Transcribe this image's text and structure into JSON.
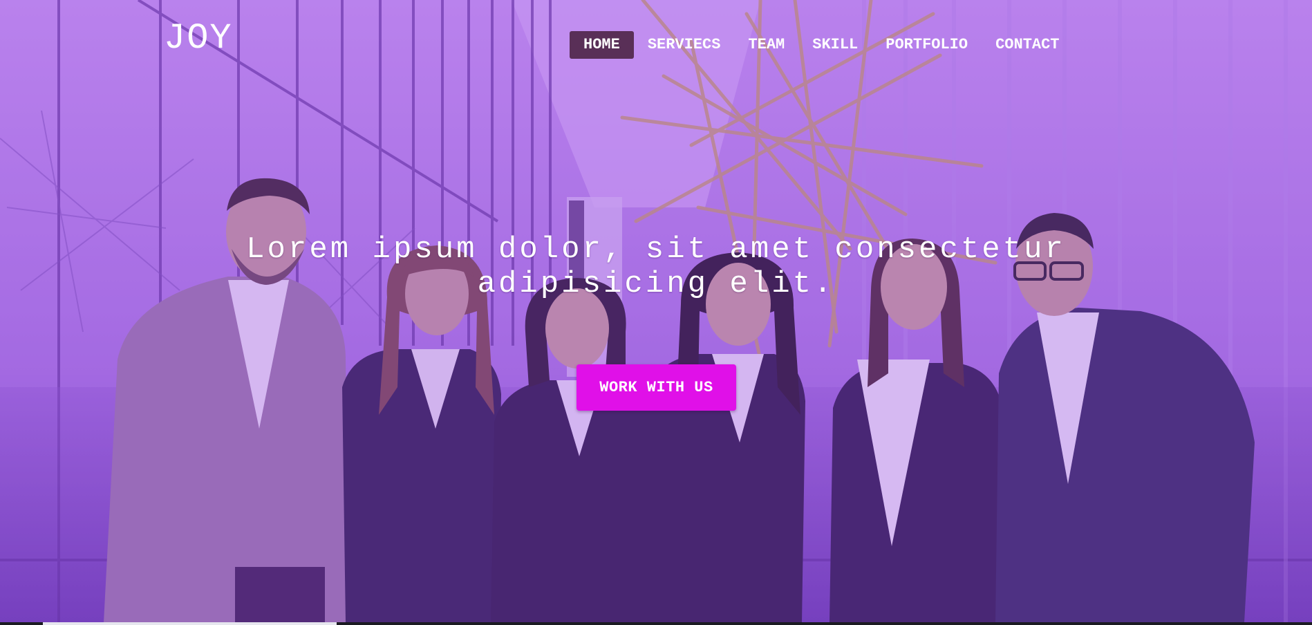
{
  "brand": {
    "logo_text": "JOY"
  },
  "nav": {
    "items": [
      {
        "label": "HOME",
        "active": true
      },
      {
        "label": "SERVIECS",
        "active": false
      },
      {
        "label": "TEAM",
        "active": false
      },
      {
        "label": "SKILL",
        "active": false
      },
      {
        "label": "PORTFOLIO",
        "active": false
      },
      {
        "label": "CONTACT",
        "active": false
      }
    ]
  },
  "hero": {
    "headline": "Lorem ipsum dolor, sit amet consectetur adipisicing elit.",
    "cta_label": "WORK WITH US",
    "background_image": "team-photo",
    "overlay_color": "#9646e6"
  },
  "colors": {
    "accent": "#e010e8",
    "nav_active_bg": "#461e3c",
    "text": "#ffffff"
  }
}
